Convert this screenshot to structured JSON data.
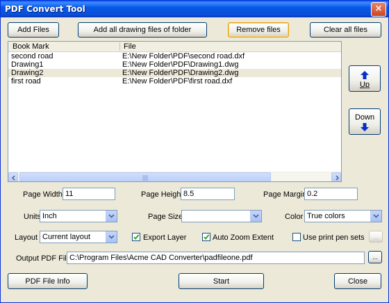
{
  "window": {
    "title": "PDF Convert Tool",
    "close_glyph": "×"
  },
  "toolbar": {
    "add_files": "Add Files",
    "add_all_drawing_files": "Add all drawing files of folder",
    "remove_files": "Remove files",
    "clear_all_files": "Clear all files"
  },
  "list": {
    "columns": [
      "Book Mark",
      "File"
    ],
    "rows": [
      {
        "bookmark": "second road",
        "file": "E:\\New Folder\\PDF\\second road.dxf"
      },
      {
        "bookmark": "Drawing1",
        "file": "E:\\New Folder\\PDF\\Drawing1.dwg"
      },
      {
        "bookmark": "Drawing2",
        "file": "E:\\New Folder\\PDF\\Drawing2.dwg"
      },
      {
        "bookmark": "first road",
        "file": "E:\\New Folder\\PDF\\first road.dxf"
      }
    ],
    "selected_row": "Drawing2"
  },
  "side": {
    "up": "Up",
    "down": "Down",
    "up_icon": "arrow-up-icon",
    "down_icon": "arrow-down-icon"
  },
  "page": {
    "width_label": "Page Width",
    "width_value": "11",
    "height_label": "Page Height",
    "height_value": "8.5",
    "margin_label": "Page Margin",
    "margin_value": "0.2"
  },
  "options": {
    "units_label": "Units",
    "units_value": "Inch",
    "page_size_label": "Page Size",
    "page_size_value": "",
    "color_label": "Color",
    "color_value": "True colors",
    "layout_label": "Layout",
    "layout_value": "Current layout",
    "export_layer_label": "Export Layer",
    "export_layer_checked": true,
    "auto_zoom_label": "Auto Zoom Extent",
    "auto_zoom_checked": true,
    "print_pen_label": "Use print pen sets",
    "print_pen_checked": false,
    "pen_button": "..."
  },
  "output": {
    "label": "Output PDF File",
    "path": "C:\\Program Files\\Acme CAD Converter\\padfileone.pdf",
    "browse": "..."
  },
  "footer": {
    "pdf_info": "PDF File Info",
    "start": "Start",
    "close": "Close"
  },
  "colors": {
    "title_bar": "#0A5EF0",
    "face": "#ECE9D8",
    "focus_border": "#E3A21A",
    "arrow": "#0A2FC4"
  }
}
